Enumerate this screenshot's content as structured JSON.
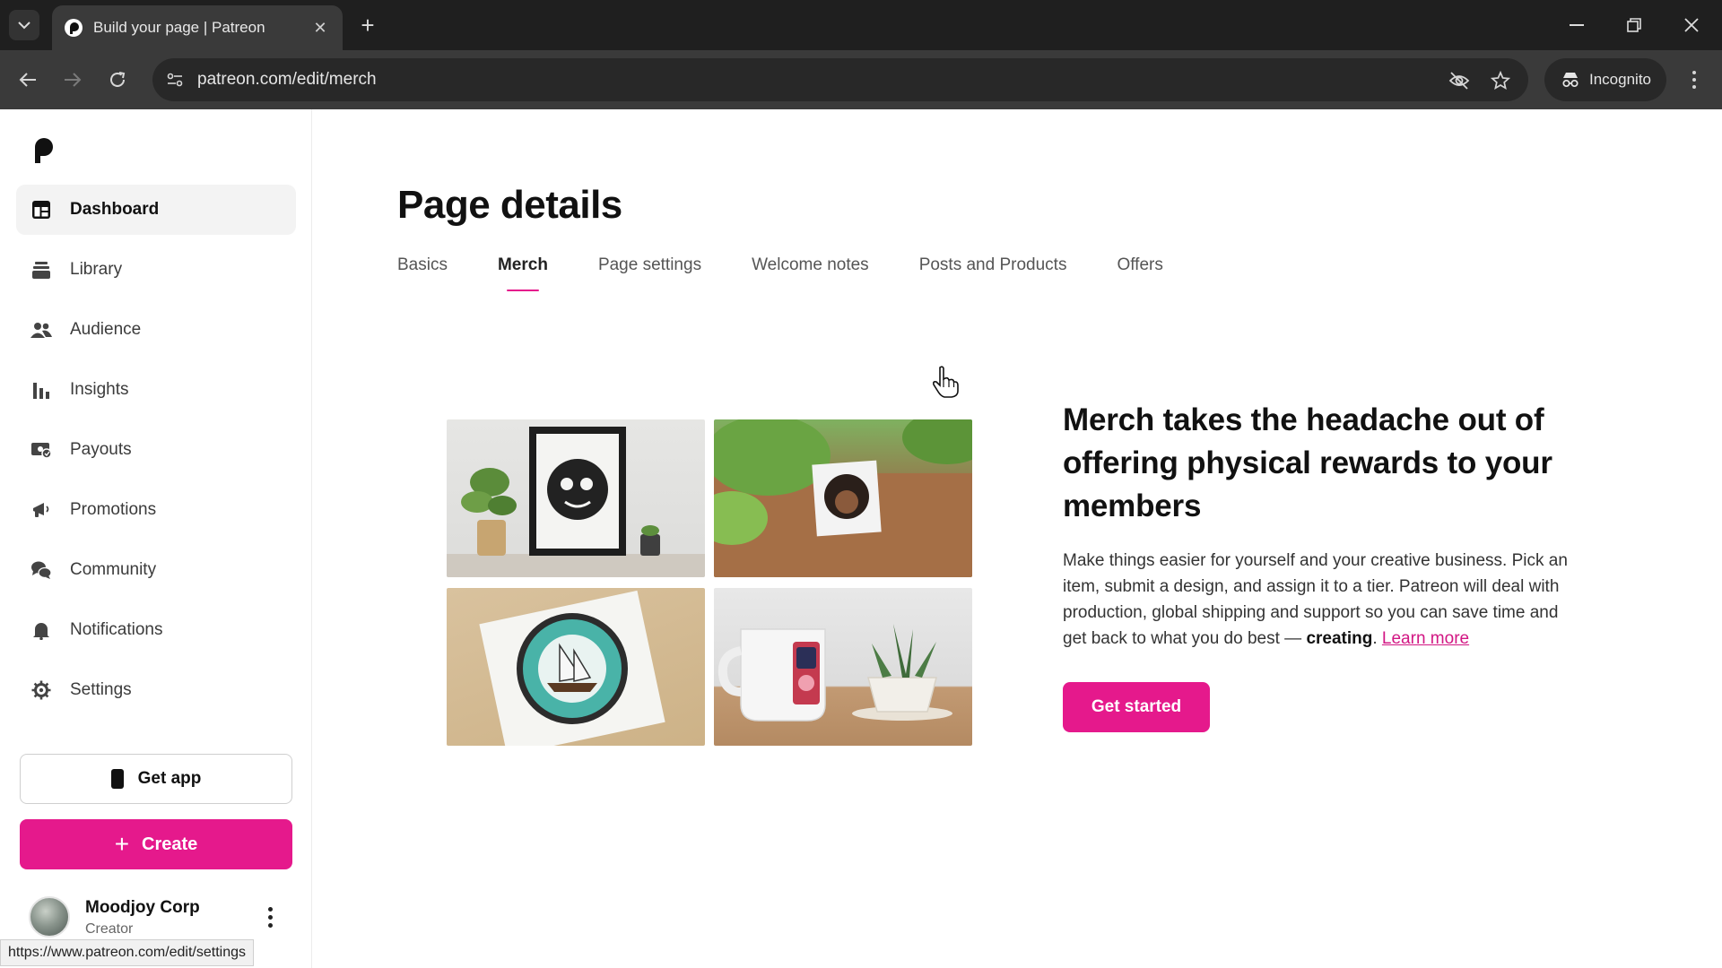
{
  "browser": {
    "tab_title": "Build your page | Patreon",
    "url": "patreon.com/edit/merch",
    "incognito_label": "Incognito",
    "status_url": "https://www.patreon.com/edit/settings"
  },
  "sidebar": {
    "items": [
      {
        "label": "Dashboard",
        "icon": "dashboard-icon",
        "active": true
      },
      {
        "label": "Library",
        "icon": "library-icon"
      },
      {
        "label": "Audience",
        "icon": "audience-icon"
      },
      {
        "label": "Insights",
        "icon": "insights-icon"
      },
      {
        "label": "Payouts",
        "icon": "payouts-icon"
      },
      {
        "label": "Promotions",
        "icon": "megaphone-icon"
      },
      {
        "label": "Community",
        "icon": "chat-bubbles-icon"
      },
      {
        "label": "Notifications",
        "icon": "bell-icon"
      },
      {
        "label": "Settings",
        "icon": "gear-icon"
      }
    ],
    "get_app_label": "Get app",
    "create_label": "Create",
    "profile": {
      "name": "Moodjoy Corp",
      "role": "Creator"
    }
  },
  "main": {
    "title": "Page details",
    "tabs": [
      {
        "label": "Basics"
      },
      {
        "label": "Merch",
        "active": true
      },
      {
        "label": "Page settings"
      },
      {
        "label": "Welcome notes"
      },
      {
        "label": "Posts and Products"
      },
      {
        "label": "Offers"
      }
    ],
    "merch": {
      "heading": "Merch takes the headache out of offering physical rewards to your members",
      "body": "Make things easier for yourself and your creative business. Pick an item, submit a design, and assign it to a tier. Patreon will deal with production, global shipping and support so you can save time and get back to what you do best — ",
      "body_bold": "creating",
      "body_end": ". ",
      "learn_more": "Learn more",
      "cta": "Get started"
    }
  },
  "colors": {
    "accent": "#e5198c",
    "link": "#d21683",
    "chrome_dark": "#1f1f1f",
    "chrome_mid": "#3a3a3a"
  }
}
